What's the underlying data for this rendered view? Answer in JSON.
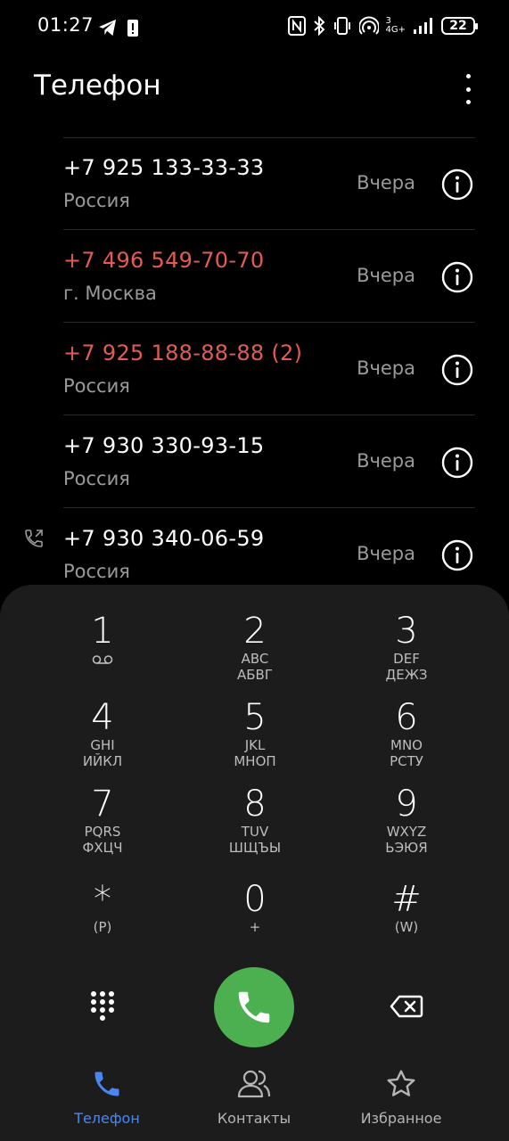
{
  "status_bar": {
    "time": "01:27",
    "battery": "22",
    "network": "4G+",
    "sim_slot": "3"
  },
  "header": {
    "title": "Телефон"
  },
  "calls": [
    {
      "number": "+7 925 133-33-33",
      "location": "Россия",
      "date": "Вчера",
      "missed": false,
      "outgoing": false
    },
    {
      "number": "+7 496 549-70-70",
      "location": "г. Москва",
      "date": "Вчера",
      "missed": true,
      "outgoing": false
    },
    {
      "number": "+7 925 188-88-88 (2)",
      "location": "Россия",
      "date": "Вчера",
      "missed": true,
      "outgoing": false
    },
    {
      "number": "+7 930 330-93-15",
      "location": "Россия",
      "date": "Вчера",
      "missed": false,
      "outgoing": false
    },
    {
      "number": "+7 930 340-06-59",
      "location": "Россия",
      "date": "Вчера",
      "missed": false,
      "outgoing": true
    }
  ],
  "dialpad": {
    "keys": [
      {
        "digit": "1",
        "line1": "",
        "line2": ""
      },
      {
        "digit": "2",
        "line1": "ABC",
        "line2": "АБВГ"
      },
      {
        "digit": "3",
        "line1": "DEF",
        "line2": "ДЕЖЗ"
      },
      {
        "digit": "4",
        "line1": "GHI",
        "line2": "ИЙКЛ"
      },
      {
        "digit": "5",
        "line1": "JKL",
        "line2": "МНОП"
      },
      {
        "digit": "6",
        "line1": "MNO",
        "line2": "РСТУ"
      },
      {
        "digit": "7",
        "line1": "PQRS",
        "line2": "ФХЦЧ"
      },
      {
        "digit": "8",
        "line1": "TUV",
        "line2": "ШЩЪЫ"
      },
      {
        "digit": "9",
        "line1": "WXYZ",
        "line2": "ЬЭЮЯ"
      },
      {
        "digit": "*",
        "line1": "(P)",
        "line2": ""
      },
      {
        "digit": "0",
        "line1": "+",
        "line2": ""
      },
      {
        "digit": "#",
        "line1": "(W)",
        "line2": ""
      }
    ]
  },
  "nav": {
    "phone": "Телефон",
    "contacts": "Контакты",
    "favorites": "Избранное"
  },
  "colors": {
    "missed": "#e35b52",
    "call_button": "#4caf50",
    "active_tab": "#4a86f0"
  }
}
